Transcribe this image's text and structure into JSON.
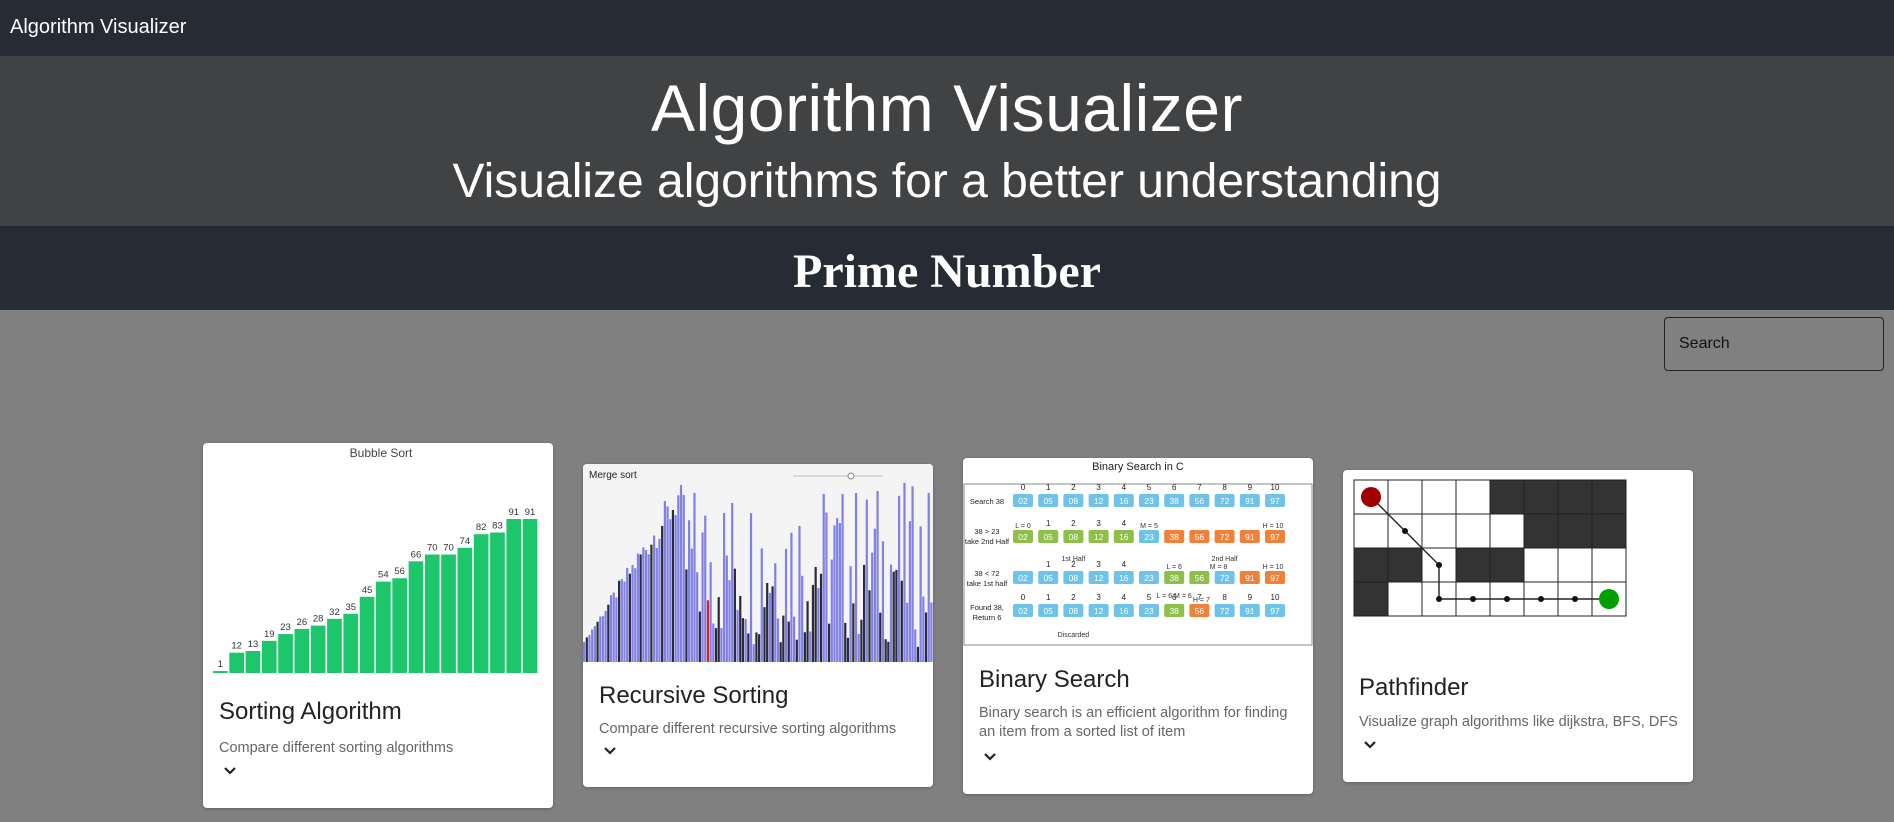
{
  "navbar": {
    "brand": "Algorithm Visualizer"
  },
  "hero": {
    "title": "Algorithm Visualizer",
    "subtitle": "Visualize algorithms for a better understanding"
  },
  "section": {
    "title": "Prime Number"
  },
  "search": {
    "placeholder": "Search"
  },
  "cards": [
    {
      "image_title": "Bubble Sort",
      "title": "Sorting Algorithm",
      "description": "Compare different sorting algorithms",
      "icon": "chevron-down-icon",
      "bar_values": [
        1,
        12,
        13,
        19,
        23,
        26,
        28,
        32,
        35,
        45,
        54,
        56,
        66,
        70,
        70,
        74,
        82,
        83,
        91,
        91
      ],
      "bar_color": "#1ec66b"
    },
    {
      "image_title": "Merge sort",
      "title": "Recursive Sorting",
      "description": "Compare different recursive sorting algorithms",
      "icon": "chevron-down-icon",
      "bar_colors": [
        "#8080e6",
        "#2a2a3a",
        "#e02020"
      ]
    },
    {
      "image_title": "Binary Search in C",
      "title": "Binary Search",
      "description": "Binary search is an efficient algorithm for finding an item from a sorted list of item",
      "icon": "chevron-down-icon",
      "indices": [
        "0",
        "1",
        "2",
        "3",
        "4",
        "5",
        "6",
        "7",
        "8",
        "9",
        "10"
      ],
      "values": [
        "02",
        "05",
        "08",
        "12",
        "16",
        "23",
        "38",
        "56",
        "72",
        "91",
        "97"
      ],
      "row_labels": [
        "Search 38",
        "38 > 23 take 2nd Half",
        "38 < 72 take 1st half",
        "Found 38, Return 6"
      ],
      "annotations": [
        "L = 0",
        "M = 5",
        "H = 10",
        "1st Half",
        "2nd Half",
        "Discarded",
        "L = 6",
        "M = 8",
        "H = 10",
        "L = 6 M = 6",
        "H = 7"
      ]
    },
    {
      "title": "Pathfinder",
      "description": "Visualize graph algorithms like dijkstra, BFS, DFS",
      "icon": "chevron-down-icon",
      "start_color": "#a00000",
      "end_color": "#00a000"
    }
  ]
}
